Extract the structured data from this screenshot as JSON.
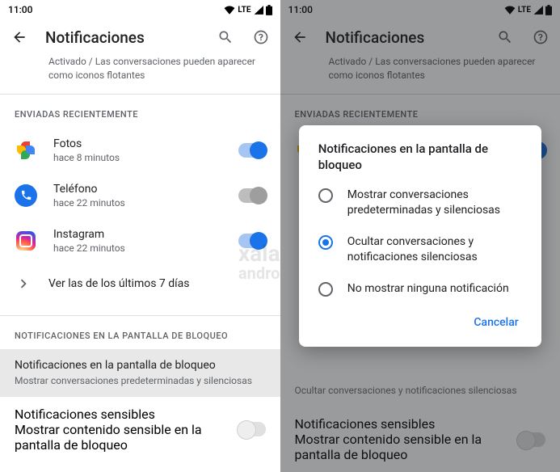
{
  "statusbar": {
    "time": "11:00",
    "net": "LTE"
  },
  "appbar": {
    "title": "Notificaciones"
  },
  "bubbles_subtext": "Activado / Las conversaciones pueden aparecer como iconos flotantes",
  "sections": {
    "recent": {
      "title": "ENVIADAS RECIENTEMENTE"
    },
    "lockscreen": {
      "title": "NOTIFICACIONES EN LA PANTALLA DE BLOQUEO"
    }
  },
  "recent_items": [
    {
      "app": "Fotos",
      "time": "hace 8 minutos",
      "toggle": "on"
    },
    {
      "app": "Teléfono",
      "time": "hace 22 minutos",
      "toggle": "off"
    },
    {
      "app": "Instagram",
      "time": "hace 22 minutos",
      "toggle": "on"
    }
  ],
  "see_all": "Ver las de los últimos 7 días",
  "lockscreen_setting": {
    "title": "Notificaciones en la pantalla de bloqueo",
    "value_full": "Mostrar conversaciones predeterminadas y silenciosas",
    "value_hidden": "Ocultar conversaciones y notificaciones silenciosas"
  },
  "sensitive_setting": {
    "title": "Notificaciones sensibles",
    "subtitle": "Mostrar contenido sensible en la pantalla de bloqueo"
  },
  "dialog": {
    "title": "Notificaciones en la pantalla de bloqueo",
    "options": [
      "Mostrar conversaciones predeterminadas y silenciosas",
      "Ocultar conversaciones y notificaciones silenciosas",
      "No mostrar ninguna notificación"
    ],
    "cancel": "Cancelar"
  },
  "watermark": {
    "line1": "xalaka",
    "line2": "android"
  }
}
